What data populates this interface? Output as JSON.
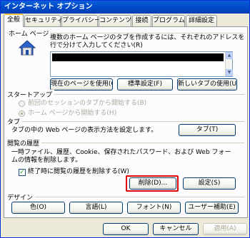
{
  "window": {
    "title": "インターネット オプション"
  },
  "tabs": [
    {
      "label": "全般"
    },
    {
      "label": "セキュリティ"
    },
    {
      "label": "プライバシー"
    },
    {
      "label": "コンテンツ"
    },
    {
      "label": "接続"
    },
    {
      "label": "プログラム"
    },
    {
      "label": "詳細設定"
    }
  ],
  "home": {
    "title": "ホーム ページ",
    "description": "複数のホーム ページのタブを作成するには、それぞれのアドレスを行で分けて入力してください(R)",
    "use_current": "現在のページを使用(C)",
    "use_default": "標準設定(F)",
    "use_new_tab": "新しいタブの使用(U)"
  },
  "startup": {
    "title": "スタートアップ",
    "option1": "前回のセッションのタブから開始する(B)",
    "option2": "ホーム ページから開始する(H)"
  },
  "tabs_section": {
    "title": "タブ",
    "description": "タブの中の Web ページの表示方法を設定します。",
    "button": "タブ(T)"
  },
  "history": {
    "title": "閲覧の履歴",
    "description": "一時ファイル、履歴、Cookie、保存されたパスワード、および Web フォームの情報を削除します。",
    "checkbox": "終了時に閲覧の履歴を削除する(W)",
    "delete_button": "削除(D)...",
    "settings_button": "設定(S)"
  },
  "design": {
    "title": "デザイン",
    "colors": "色(O)",
    "languages": "言語(L)",
    "fonts": "フォント(N)",
    "accessibility": "ユーザー補助(E)"
  },
  "footer": {
    "ok": "OK",
    "cancel": "キャンセル",
    "apply": "適用(A)"
  }
}
